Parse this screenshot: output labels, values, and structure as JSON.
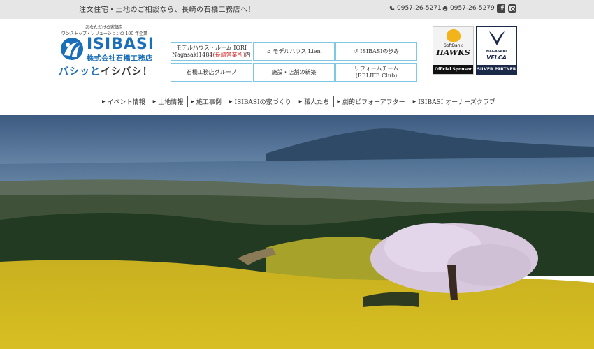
{
  "topbar": {
    "tagline": "注文住宅・土地のご相談なら、長崎の石橋工務店へ！",
    "phone1": "0957-26-5271",
    "phone2": "0957-26-5279",
    "phone_icon": "phone-icon",
    "fax_icon": "fax-icon",
    "social": [
      "facebook-icon",
      "instagram-icon"
    ]
  },
  "logo": {
    "line1": "あなただけの家価を",
    "line2": "- ワンストップ・ソリューションの 100 年企業 -",
    "brand": "ISIBASI",
    "company": "株式会社石橋工務店",
    "slogan_a": "バシッと",
    "slogan_b": "イシバシ",
    "slogan_c": "！",
    "brand_color": "#1a6fb8"
  },
  "buttons": {
    "b1_line1": "モデルハウス・ルーム IORI",
    "b1_line2a": "Nagasaki1484",
    "b1_line2b": "(長崎営業所)",
    "b1_line2c": "内",
    "b2": "モデルハウス Lien",
    "b3": "ISIBASIの歩み",
    "b4": "石橋工務店グループ",
    "b5": "施設・店舗の新築",
    "b6_line1": "リフォームチーム",
    "b6_line2": "(RELIFE Club)",
    "border_color": "#7ec8e3"
  },
  "sponsors": {
    "hawks_line1": "SoftBank",
    "hawks_line2": "HAWKS",
    "hawks_foot": "Official Sponsor",
    "velca_line1": "NAGASAKI",
    "velca_line2": "VELCA",
    "velca_foot": "SILVER PARTNER"
  },
  "nav": [
    "イベント情報",
    "土地情報",
    "施工事例",
    "ISIBASIの家づくり",
    "職人たち",
    "劇的ビフォーアフター",
    "ISIBASI オーナーズクラブ"
  ]
}
